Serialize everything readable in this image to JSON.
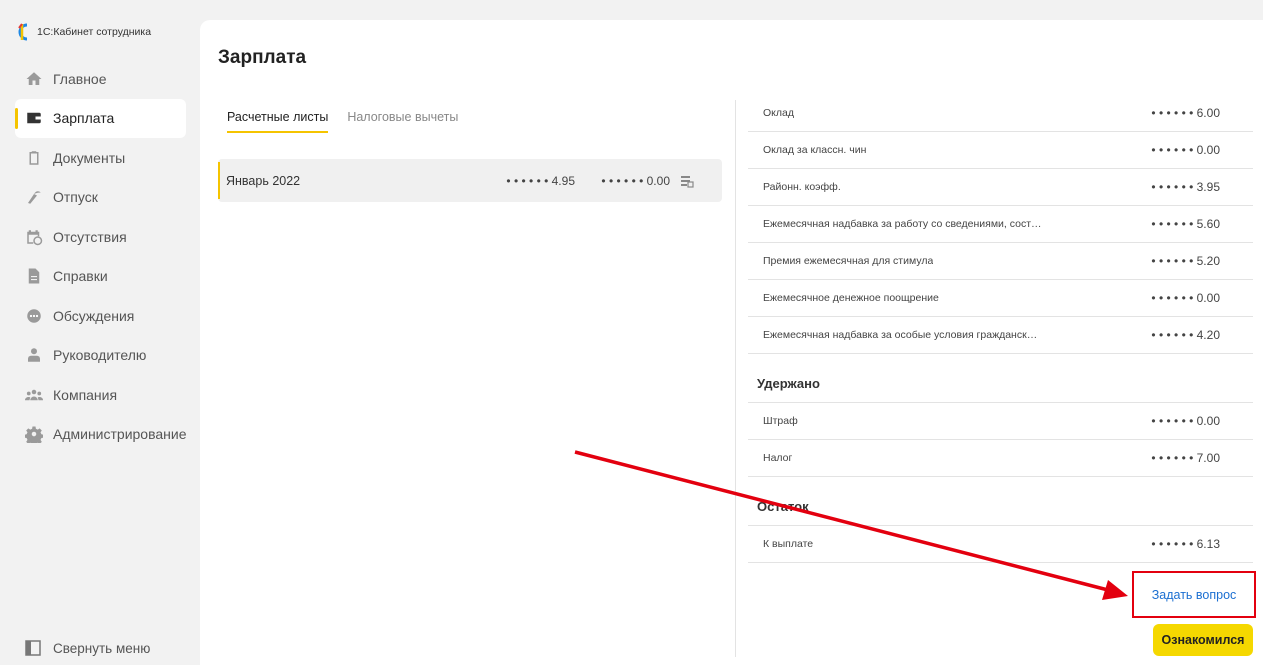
{
  "app": {
    "title": "1С:Кабинет сотрудника"
  },
  "sidebar": {
    "items": [
      {
        "label": "Главное",
        "icon": "home-icon",
        "active": false
      },
      {
        "label": "Зарплата",
        "icon": "wallet-icon",
        "active": true
      },
      {
        "label": "Документы",
        "icon": "clipboard-icon",
        "active": false
      },
      {
        "label": "Отпуск",
        "icon": "beach-icon",
        "active": false
      },
      {
        "label": "Отсутствия",
        "icon": "calendar-clock-icon",
        "active": false
      },
      {
        "label": "Справки",
        "icon": "document-icon",
        "active": false
      },
      {
        "label": "Обсуждения",
        "icon": "chat-icon",
        "active": false
      },
      {
        "label": "Руководителю",
        "icon": "manager-icon",
        "active": false
      },
      {
        "label": "Компания",
        "icon": "team-icon",
        "active": false
      },
      {
        "label": "Администрирование",
        "icon": "gear-icon",
        "active": false
      }
    ],
    "collapse_label": "Свернуть меню"
  },
  "main": {
    "title": "Зарплата",
    "tabs": [
      {
        "label": "Расчетные листы",
        "active": true
      },
      {
        "label": "Налоговые вычеты",
        "active": false
      }
    ],
    "payslips": [
      {
        "period": "Январь 2022",
        "accrued": "• • • • • • 4.95",
        "paid": "• • • • • • 0.00"
      }
    ]
  },
  "details": {
    "accruals": [
      {
        "label": "Оклад",
        "amount": "• • • • • • 6.00"
      },
      {
        "label": "Оклад за классн. чин",
        "amount": "• • • • • • 0.00"
      },
      {
        "label": "Районн. коэфф.",
        "amount": "• • • • • • 3.95"
      },
      {
        "label": "Ежемесячная надбавка за работу со сведениями, сост…",
        "amount": "• • • • • • 5.60"
      },
      {
        "label": "Премия ежемесячная для стимула",
        "amount": "• • • • • • 5.20"
      },
      {
        "label": "Ежемесячное денежное поощрение",
        "amount": "• • • • • • 0.00"
      },
      {
        "label": "Ежемесячная надбавка за особые условия гражданск…",
        "amount": "• • • • • • 4.20"
      }
    ],
    "withheld_title": "Удержано",
    "withheld": [
      {
        "label": "Штраф",
        "amount": "• • • • • • 0.00"
      },
      {
        "label": "Налог",
        "amount": "• • • • • • 7.00"
      }
    ],
    "balance_title": "Остаток",
    "balance": [
      {
        "label": "К выплате",
        "amount": "• • • • • • 6.13"
      }
    ]
  },
  "actions": {
    "ask_label": "Задать вопрос",
    "ack_label": "Ознакомился"
  },
  "colors": {
    "accent": "#f5c400",
    "link": "#1b6fd1",
    "annotation": "#e3000f"
  }
}
